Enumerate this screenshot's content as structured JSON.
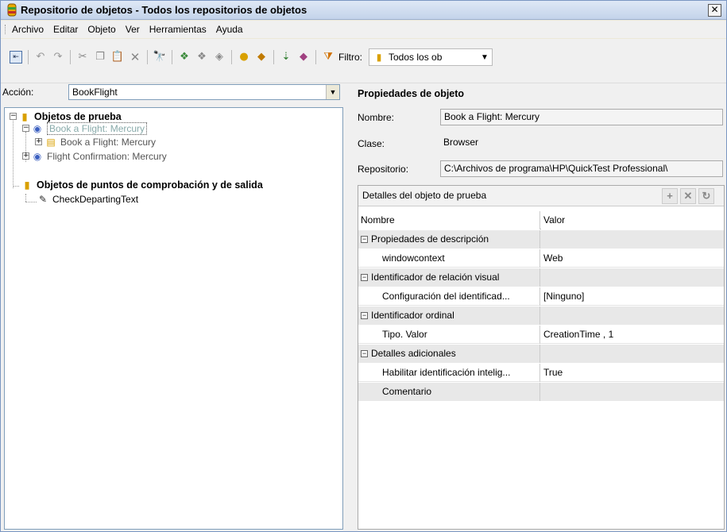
{
  "window": {
    "title": "Repositorio de objetos - Todos los repositorios de objetos",
    "close": "✕"
  },
  "menu": [
    "Archivo",
    "Editar",
    "Objeto",
    "Ver",
    "Herramientas",
    "Ayuda"
  ],
  "toolbar": {
    "filter_label": "Filtro:",
    "filter_value": "Todos los ob"
  },
  "accion": {
    "label": "Acción:",
    "value": "BookFlight"
  },
  "tree": {
    "root1": "Objetos de prueba",
    "browser1": "Book a Flight: Mercury",
    "page1": "Book a Flight: Mercury",
    "browser2": "Flight Confirmation: Mercury",
    "root2": "Objetos de puntos de comprobación y de salida",
    "check1": "CheckDepartingText"
  },
  "props": {
    "title": "Propiedades de objeto",
    "nombre_label": "Nombre:",
    "nombre_value": "Book a Flight: Mercury",
    "clase_label": "Clase:",
    "clase_value": "Browser",
    "repo_label": "Repositorio:",
    "repo_value": "C:\\Archivos de programa\\HP\\QuickTest Professional\\"
  },
  "details": {
    "title": "Detalles del objeto de prueba",
    "col_name": "Nombre",
    "col_value": "Valor",
    "rows": [
      {
        "name": "Propiedades de descripción",
        "value": ""
      },
      {
        "name": "windowcontext",
        "value": "Web"
      },
      {
        "name": "Identificador de relación visual",
        "value": ""
      },
      {
        "name": "Configuración del identificad...",
        "value": "[Ninguno]"
      },
      {
        "name": "Identificador ordinal",
        "value": ""
      },
      {
        "name": "Tipo. Valor",
        "value": "CreationTime , 1"
      },
      {
        "name": "Detalles adicionales",
        "value": ""
      },
      {
        "name": "Habilitar identificación intelig...",
        "value": "True"
      },
      {
        "name": "Comentario",
        "value": ""
      }
    ]
  }
}
